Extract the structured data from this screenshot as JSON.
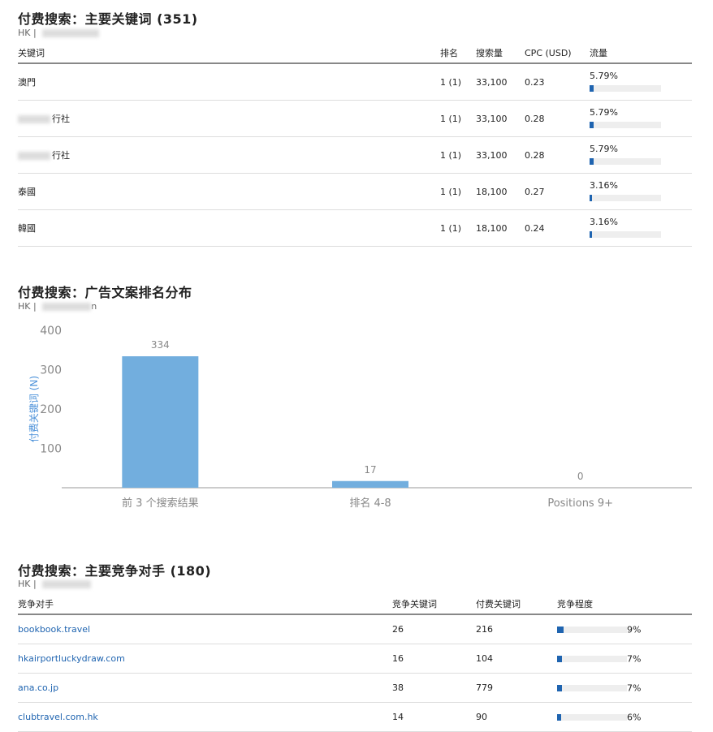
{
  "keywords_section": {
    "title": "付费搜索：主要关键词 (351)",
    "subtitle": "HK | ",
    "columns": [
      "关键词",
      "排名",
      "搜索量",
      "CPC (USD)",
      "流量"
    ],
    "rows": [
      {
        "keyword": "澳門",
        "rank": "1 (1)",
        "volume": "33,100",
        "cpc": "0.23",
        "traffic": "5.79%",
        "traffic_value": 5.79
      },
      {
        "keyword": "行社",
        "rank": "1 (1)",
        "volume": "33,100",
        "cpc": "0.28",
        "traffic": "5.79%",
        "traffic_value": 5.79
      },
      {
        "keyword": "行社",
        "rank": "1 (1)",
        "volume": "33,100",
        "cpc": "0.28",
        "traffic": "5.79%",
        "traffic_value": 5.79
      },
      {
        "keyword": "泰國",
        "rank": "1 (1)",
        "volume": "18,100",
        "cpc": "0.27",
        "traffic": "3.16%",
        "traffic_value": 3.16
      },
      {
        "keyword": "韓國",
        "rank": "1 (1)",
        "volume": "18,100",
        "cpc": "0.24",
        "traffic": "3.16%",
        "traffic_value": 3.16
      }
    ]
  },
  "chart_section": {
    "title": "付费搜索：广告文案排名分布",
    "subtitle": "HK | ",
    "subtitle_tail": "n"
  },
  "chart_data": {
    "type": "bar",
    "categories": [
      "前 3 个搜索结果",
      "排名 4-8",
      "Positions 9+"
    ],
    "values": [
      334,
      17,
      0
    ],
    "ylabel": "付费关键词 (N)",
    "yticks": [
      "400",
      "300",
      "200",
      "100"
    ],
    "ylim": [
      0,
      400
    ],
    "bar_color": "#72aede",
    "grid": false
  },
  "competitors_section": {
    "title": "付费搜索：主要竞争对手 (180)",
    "subtitle": "HK | ",
    "columns": [
      "竞争对手",
      "竞争关键词",
      "付费关键词",
      "竞争程度"
    ],
    "rows": [
      {
        "domain": "bookbook.travel",
        "common": "26",
        "paid": "216",
        "level": "9%",
        "level_value": 9
      },
      {
        "domain": "hkairportluckydraw.com",
        "common": "16",
        "paid": "104",
        "level": "7%",
        "level_value": 7
      },
      {
        "domain": "ana.co.jp",
        "common": "38",
        "paid": "779",
        "level": "7%",
        "level_value": 7
      },
      {
        "domain": "clubtravel.com.hk",
        "common": "14",
        "paid": "90",
        "level": "6%",
        "level_value": 6
      }
    ]
  },
  "colors": {
    "accent": "#1f64b0",
    "bar": "#72aede",
    "axis_label": "#4a90d9"
  }
}
